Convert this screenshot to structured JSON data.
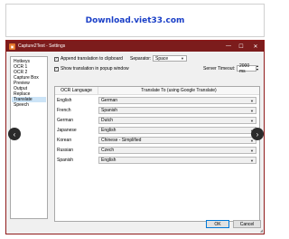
{
  "banner": {
    "text": "Download.viet33.com"
  },
  "window": {
    "title": "Capture2Text - Settings"
  },
  "nav": {
    "items": [
      "Hotkeys",
      "OCR 1",
      "OCR 2",
      "Capture Box",
      "Preview",
      "Output",
      "Replace",
      "Translate",
      "Speech"
    ],
    "selected_index": 7
  },
  "options": {
    "append_label": "Append translation to clipboard",
    "append_checked": true,
    "separator_label": "Separator:",
    "separator_value": "Space",
    "popup_label": "Show translation in popup window",
    "popup_checked": true,
    "timeout_label": "Server Timeout:",
    "timeout_value": "2000 ms"
  },
  "table": {
    "col1": "OCR Language",
    "col2": "Translate To (using Google Translate)",
    "rows": [
      {
        "from": "English",
        "to": "German"
      },
      {
        "from": "French",
        "to": "Spanish"
      },
      {
        "from": "German",
        "to": "Dutch"
      },
      {
        "from": "Japanese",
        "to": "English"
      },
      {
        "from": "Korean",
        "to": "Chinese - Simplified"
      },
      {
        "from": "Russian",
        "to": "Czech"
      },
      {
        "from": "Spanish",
        "to": "English"
      }
    ]
  },
  "buttons": {
    "ok": "OK",
    "cancel": "Cancel"
  },
  "colors": {
    "titlebar": "#7c1c1c",
    "banner_text": "#1a3fc7",
    "selected": "#cce4f7"
  }
}
